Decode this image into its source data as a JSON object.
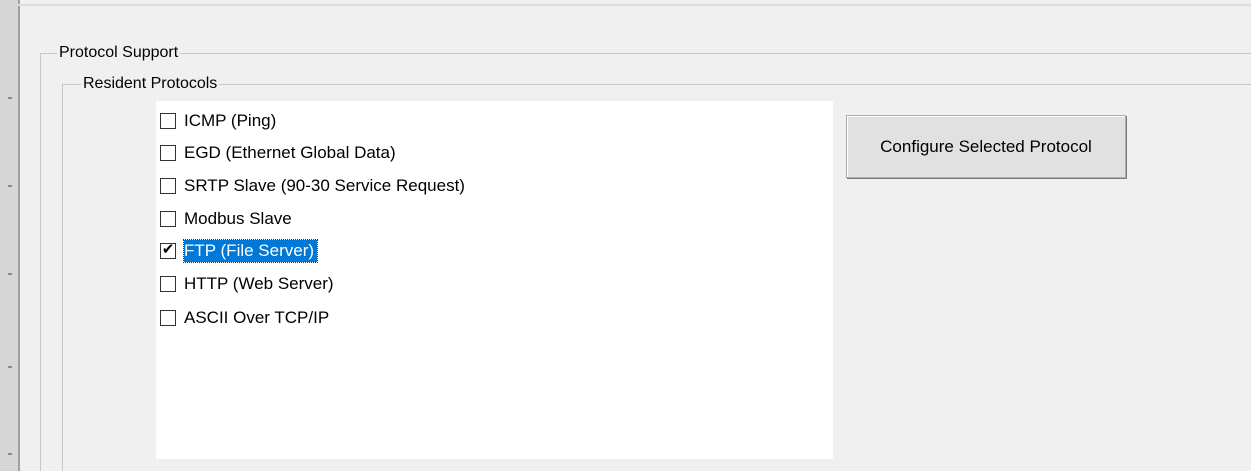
{
  "protocol_support": {
    "group_label": "Protocol Support",
    "resident_protocols": {
      "group_label": "Resident Protocols",
      "items": [
        {
          "label": "ICMP (Ping)",
          "checked": false,
          "selected": false
        },
        {
          "label": "EGD (Ethernet Global Data)",
          "checked": false,
          "selected": false
        },
        {
          "label": "SRTP Slave (90-30 Service Request)",
          "checked": false,
          "selected": false
        },
        {
          "label": "Modbus Slave",
          "checked": false,
          "selected": false
        },
        {
          "label": "FTP (File Server)",
          "checked": true,
          "selected": true
        },
        {
          "label": "HTTP (Web Server)",
          "checked": false,
          "selected": false
        },
        {
          "label": "ASCII Over TCP/IP",
          "checked": false,
          "selected": false
        }
      ]
    },
    "configure_button_label": "Configure Selected Protocol"
  },
  "colors": {
    "selection_bg": "#0078d7",
    "selection_text": "#ffffff",
    "window_bg": "#f0f0f0",
    "list_bg": "#ffffff"
  }
}
